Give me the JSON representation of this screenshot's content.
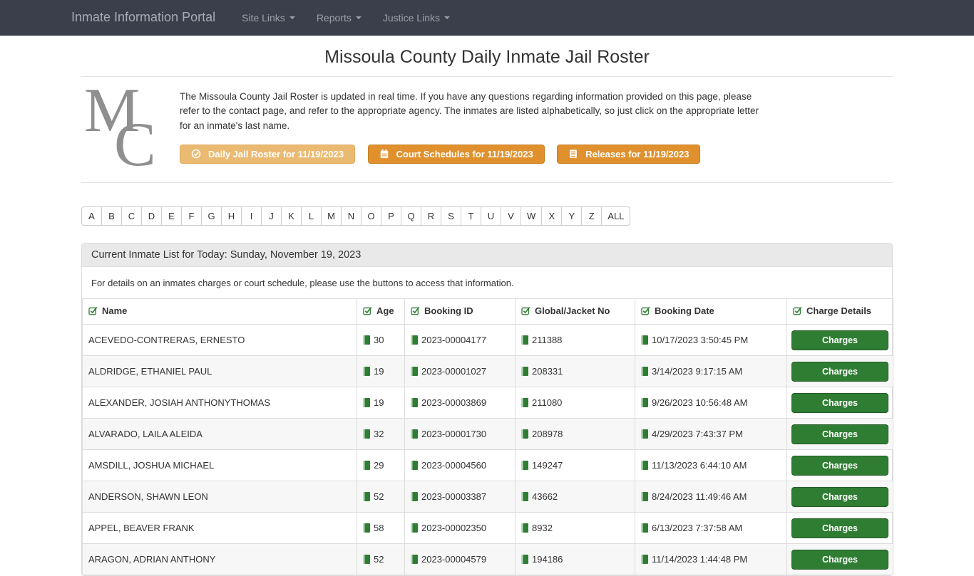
{
  "navbar": {
    "brand": "Inmate Information Portal",
    "links": [
      {
        "label": "Site Links"
      },
      {
        "label": "Reports"
      },
      {
        "label": "Justice Links"
      }
    ]
  },
  "page": {
    "title": "Missoula County Daily Inmate Jail Roster",
    "logo_monogram_m": "M",
    "logo_monogram_c": "C",
    "intro": "The Missoula County Jail Roster is updated in real time. If you have any questions regarding information provided on this page, please refer to the contact page, and refer to the appropriate agency. The inmates are listed alphabetically, so just click on the appropriate letter for an inmate's last name."
  },
  "action_buttons": {
    "daily_roster": "Daily Jail Roster for 11/19/2023",
    "court_schedules": "Court Schedules for 11/19/2023",
    "releases": "Releases for 11/19/2023"
  },
  "alphabet_nav": [
    "A",
    "B",
    "C",
    "D",
    "E",
    "F",
    "G",
    "H",
    "I",
    "J",
    "K",
    "L",
    "M",
    "N",
    "O",
    "P",
    "Q",
    "R",
    "S",
    "T",
    "U",
    "V",
    "W",
    "X",
    "Y",
    "Z",
    "ALL"
  ],
  "inmate_panel": {
    "heading": "Current Inmate List for Today: Sunday, November 19, 2023",
    "note": "For details on an inmates charges or court schedule, please use the buttons to access that information.",
    "columns": {
      "name": "Name",
      "age": "Age",
      "booking_id": "Booking ID",
      "jacket": "Global/Jacket No",
      "booking_date": "Booking Date",
      "charges": "Charge Details"
    },
    "charges_button_label": "Charges",
    "rows": [
      {
        "name": "ACEVEDO-CONTRERAS, ERNESTO",
        "age": "30",
        "booking_id": "2023-00004177",
        "jacket": "211388",
        "booking_date": "10/17/2023 3:50:45 PM"
      },
      {
        "name": "ALDRIDGE, ETHANIEL PAUL",
        "age": "19",
        "booking_id": "2023-00001027",
        "jacket": "208331",
        "booking_date": "3/14/2023 9:17:15 AM"
      },
      {
        "name": "ALEXANDER, JOSIAH ANTHONYTHOMAS",
        "age": "19",
        "booking_id": "2023-00003869",
        "jacket": "211080",
        "booking_date": "9/26/2023 10:56:48 AM"
      },
      {
        "name": "ALVARADO, LAILA ALEIDA",
        "age": "32",
        "booking_id": "2023-00001730",
        "jacket": "208978",
        "booking_date": "4/29/2023 7:43:37 PM"
      },
      {
        "name": "AMSDILL, JOSHUA MICHAEL",
        "age": "29",
        "booking_id": "2023-00004560",
        "jacket": "149247",
        "booking_date": "11/13/2023 6:44:10 AM"
      },
      {
        "name": "ANDERSON, SHAWN LEON",
        "age": "52",
        "booking_id": "2023-00003387",
        "jacket": "43662",
        "booking_date": "8/24/2023 11:49:46 AM"
      },
      {
        "name": "APPEL, BEAVER FRANK",
        "age": "58",
        "booking_id": "2023-00002350",
        "jacket": "8932",
        "booking_date": "6/13/2023 7:37:58 AM"
      },
      {
        "name": "ARAGON, ADRIAN ANTHONY",
        "age": "52",
        "booking_id": "2023-00004579",
        "jacket": "194186",
        "booking_date": "11/14/2023 1:44:48 PM"
      }
    ]
  },
  "colors": {
    "navbar_bg": "#3a3f4b",
    "accent_orange": "#e0912e",
    "accent_orange_light": "#eaba72",
    "success_green": "#2e7d32"
  }
}
